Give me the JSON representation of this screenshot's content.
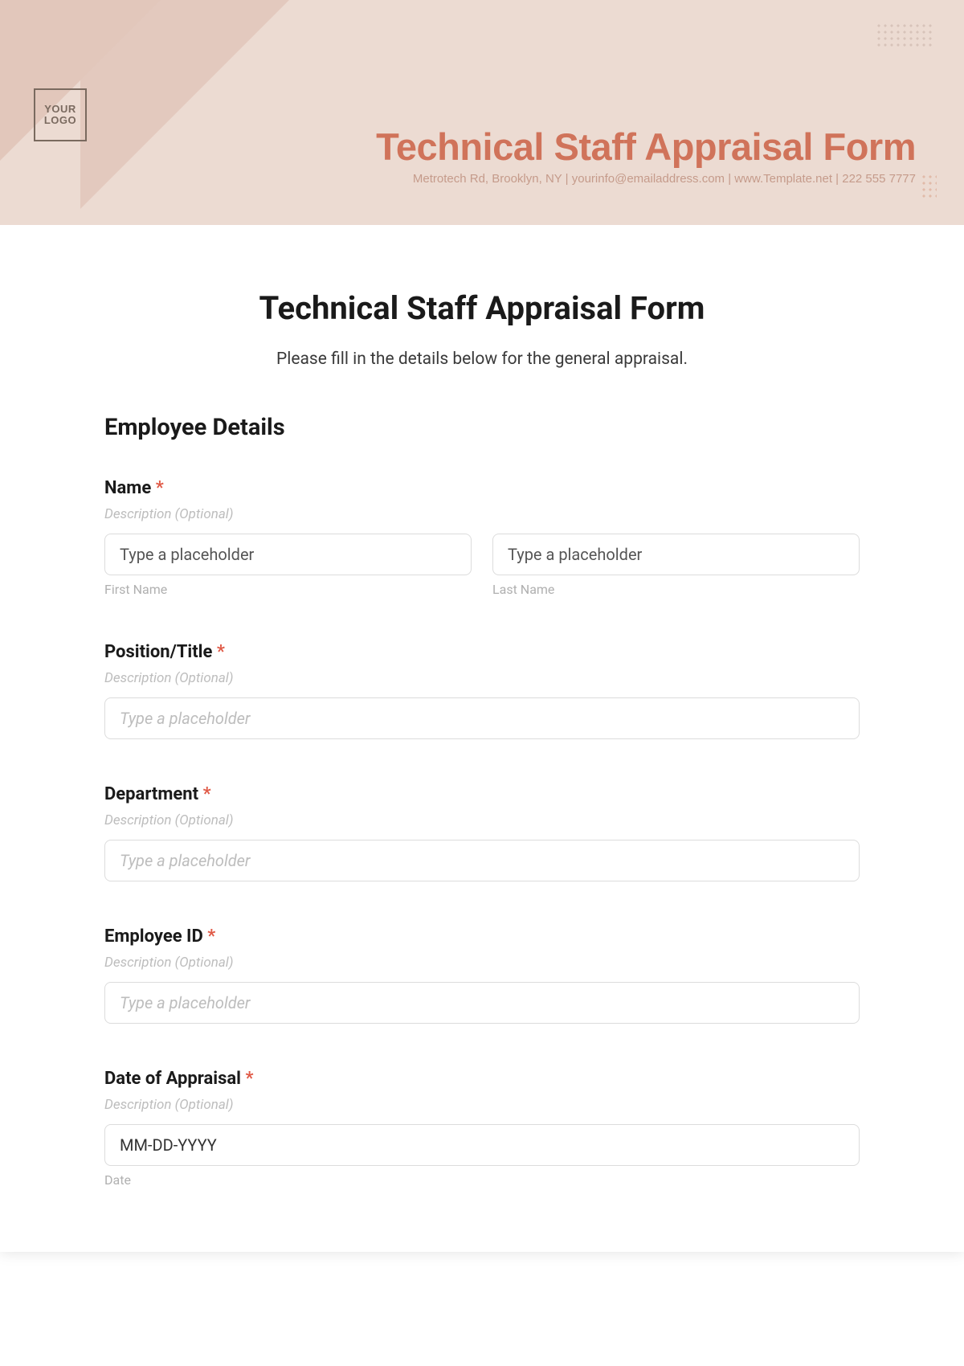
{
  "header": {
    "logo_text": "YOUR LOGO",
    "title": "Technical Staff Appraisal Form",
    "info": "Metrotech Rd, Brooklyn, NY  |  yourinfo@emailaddress.com  |  www.Template.net  |  222 555 7777"
  },
  "form": {
    "title": "Technical Staff Appraisal Form",
    "subtitle": "Please fill in the details below for the general appraisal.",
    "section": "Employee Details",
    "desc_text": "Description (Optional)",
    "placeholder_text": "Type a placeholder",
    "fields": {
      "name": {
        "label": "Name",
        "first_sub": "First Name",
        "last_sub": "Last Name"
      },
      "position": {
        "label": "Position/Title"
      },
      "department": {
        "label": "Department"
      },
      "employee_id": {
        "label": "Employee ID"
      },
      "date": {
        "label": "Date of Appraisal",
        "placeholder": "MM-DD-YYYY",
        "sub": "Date"
      }
    },
    "required_mark": "*"
  }
}
